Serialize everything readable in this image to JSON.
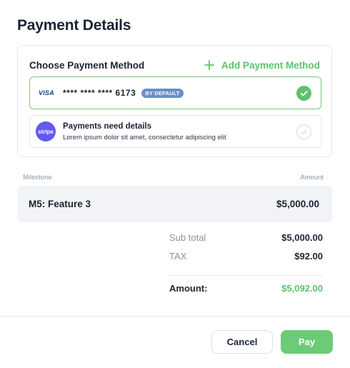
{
  "page": {
    "title": "Payment Details"
  },
  "payment_methods": {
    "heading": "Choose Payment Method",
    "add_label": "Add Payment Method",
    "card": {
      "brand": "VISA",
      "number": "**** **** **** 6173",
      "badge": "BY DEFAULT",
      "selected": true
    },
    "stripe": {
      "logo": "stripe",
      "title": "Payments need details",
      "description": "Lorem ipsum dolor sit amet, consectetur adipiscing elit",
      "selected": false
    }
  },
  "milestones": {
    "col_milestone": "Milestone",
    "col_amount": "Amount",
    "rows": [
      {
        "name": "M5: Feature 3",
        "amount": "$5,000.00"
      }
    ]
  },
  "summary": {
    "subtotal_label": "Sub total",
    "subtotal_value": "$5,000.00",
    "tax_label": "TAX",
    "tax_value": "$92.00",
    "amount_label": "Amount:",
    "amount_value": "$5,092.00"
  },
  "actions": {
    "cancel_label": "Cancel",
    "pay_label": "Pay"
  },
  "colors": {
    "accent": "#5cc36b",
    "stripe": "#6358f0",
    "badge": "#6a8fc7"
  }
}
